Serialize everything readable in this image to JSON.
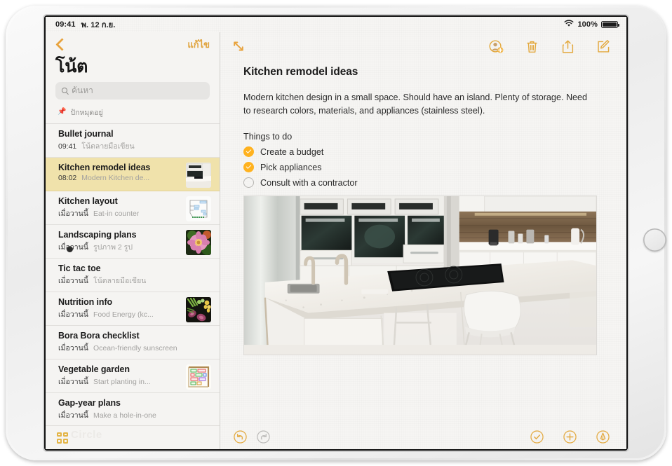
{
  "device": {
    "home_button": "home-button",
    "camera": "front-camera"
  },
  "status_bar": {
    "time": "09:41",
    "date": "พ. 12 ก.ย.",
    "wifi_icon": "wifi-icon",
    "battery_percent": "100%",
    "battery_icon": "battery-full-icon"
  },
  "sidebar": {
    "back_icon": "back-chevron-icon",
    "edit_label": "แก้ไข",
    "title": "โน้ต",
    "search": {
      "placeholder": "ค้นหา",
      "icon": "search-icon"
    },
    "pinned_label": "ปักหมุดอยู่",
    "pin_icon": "pin-icon",
    "gallery_icon": "grid-gallery-icon",
    "watermark": "Circle",
    "notes": [
      {
        "title": "Bullet journal",
        "time": "09:41",
        "snippet": "โน้ตลายมือเขียน",
        "thumb": "none",
        "selected": false
      },
      {
        "title": "Kitchen remodel ideas",
        "time": "08:02",
        "snippet": "Modern Kitchen de...",
        "thumb": "kitchen",
        "selected": true
      },
      {
        "title": "Kitchen layout",
        "time": "เมื่อวานนี้",
        "snippet": "Eat-in counter",
        "thumb": "floorplan",
        "selected": false
      },
      {
        "title": "Landscaping plans",
        "time": "เมื่อวานนี้",
        "snippet": "รูปภาพ 2 รูป",
        "thumb": "flower",
        "selected": false
      },
      {
        "title": "Tic tac toe",
        "time": "เมื่อวานนี้",
        "snippet": "โน้ตลายมือเขียน",
        "thumb": "none",
        "selected": false
      },
      {
        "title": "Nutrition info",
        "time": "เมื่อวานนี้",
        "snippet": "Food Energy (kc...",
        "thumb": "veggies",
        "selected": false
      },
      {
        "title": "Bora Bora checklist",
        "time": "เมื่อวานนี้",
        "snippet": "Ocean-friendly sunscreen",
        "thumb": "none",
        "selected": false
      },
      {
        "title": "Vegetable garden",
        "time": "เมื่อวานนี้",
        "snippet": "Start planting in...",
        "thumb": "gardenplan",
        "selected": false
      },
      {
        "title": "Gap-year plans",
        "time": "เมื่อวานนี้",
        "snippet": "Make a hole-in-one",
        "thumb": "none",
        "selected": false
      }
    ]
  },
  "note": {
    "expand_icon": "expand-arrows-icon",
    "toolbar": [
      {
        "name": "add-person-icon",
        "label": "Add People"
      },
      {
        "name": "trash-icon",
        "label": "Delete"
      },
      {
        "name": "share-icon",
        "label": "Share"
      },
      {
        "name": "compose-icon",
        "label": "New Note"
      }
    ],
    "title": "Kitchen remodel ideas",
    "paragraph": "Modern kitchen design in a small space. Should have an island. Plenty of storage. Need to research colors, materials, and appliances (stainless steel).",
    "todo_heading": "Things to do",
    "todos": [
      {
        "label": "Create a budget",
        "checked": true
      },
      {
        "label": "Pick appliances",
        "checked": true
      },
      {
        "label": "Consult with a contractor",
        "checked": false
      }
    ],
    "photo_alt": "Modern white kitchen with island and cooktop",
    "bottom_bar": {
      "undo_icon": "undo-icon",
      "redo_icon": "redo-icon",
      "checklist_icon": "checklist-icon",
      "add_icon": "plus-icon",
      "markup_icon": "markup-pen-icon"
    }
  },
  "colors": {
    "accent": "#e8a33d",
    "check_yellow": "#ffb21f",
    "selection": "#f0e2ab",
    "screen_bg": "#f6f5f3",
    "disabled": "#bdbcba"
  }
}
